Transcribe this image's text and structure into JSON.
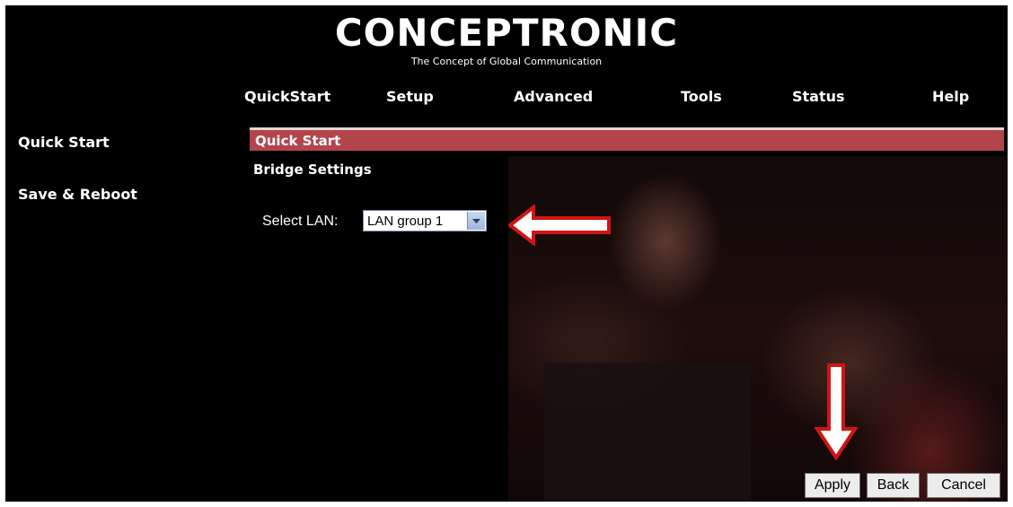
{
  "brand": {
    "logo_text": "CONCEPTRONIC",
    "tagline": "The Concept of Global Communication"
  },
  "nav": {
    "items": [
      "QuickStart",
      "Setup",
      "Advanced",
      "Tools",
      "Status",
      "Help"
    ]
  },
  "sidebar": {
    "items": [
      "Quick Start",
      "Save & Reboot"
    ]
  },
  "section": {
    "title": "Quick Start",
    "subtitle": "Bridge Settings"
  },
  "form": {
    "select_label": "Select LAN:",
    "lan_value": "LAN group 1"
  },
  "buttons": {
    "apply": "Apply",
    "back": "Back",
    "cancel": "Cancel"
  },
  "colors": {
    "background": "#000000",
    "section_bar": "#b2454b",
    "annotation_arrow": "#d11414"
  }
}
